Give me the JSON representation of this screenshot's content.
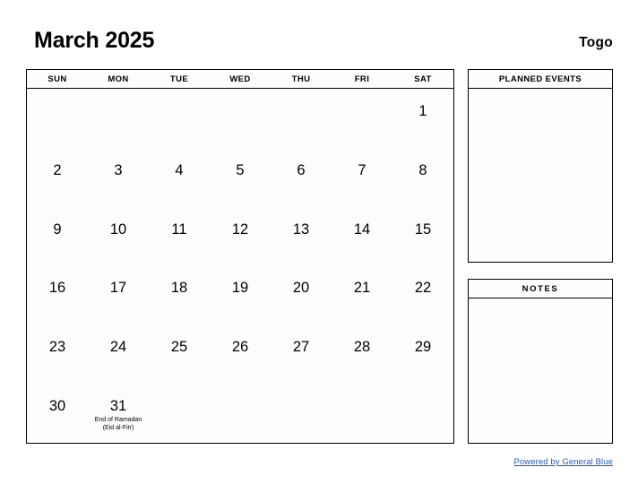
{
  "header": {
    "title": "March 2025",
    "region": "Togo"
  },
  "calendar": {
    "weekdays": [
      "SUN",
      "MON",
      "TUE",
      "WED",
      "THU",
      "FRI",
      "SAT"
    ],
    "weeks": [
      [
        {
          "day": "",
          "event": ""
        },
        {
          "day": "",
          "event": ""
        },
        {
          "day": "",
          "event": ""
        },
        {
          "day": "",
          "event": ""
        },
        {
          "day": "",
          "event": ""
        },
        {
          "day": "",
          "event": ""
        },
        {
          "day": "1",
          "event": ""
        }
      ],
      [
        {
          "day": "2",
          "event": ""
        },
        {
          "day": "3",
          "event": ""
        },
        {
          "day": "4",
          "event": ""
        },
        {
          "day": "5",
          "event": ""
        },
        {
          "day": "6",
          "event": ""
        },
        {
          "day": "7",
          "event": ""
        },
        {
          "day": "8",
          "event": ""
        }
      ],
      [
        {
          "day": "9",
          "event": ""
        },
        {
          "day": "10",
          "event": ""
        },
        {
          "day": "11",
          "event": ""
        },
        {
          "day": "12",
          "event": ""
        },
        {
          "day": "13",
          "event": ""
        },
        {
          "day": "14",
          "event": ""
        },
        {
          "day": "15",
          "event": ""
        }
      ],
      [
        {
          "day": "16",
          "event": ""
        },
        {
          "day": "17",
          "event": ""
        },
        {
          "day": "18",
          "event": ""
        },
        {
          "day": "19",
          "event": ""
        },
        {
          "day": "20",
          "event": ""
        },
        {
          "day": "21",
          "event": ""
        },
        {
          "day": "22",
          "event": ""
        }
      ],
      [
        {
          "day": "23",
          "event": ""
        },
        {
          "day": "24",
          "event": ""
        },
        {
          "day": "25",
          "event": ""
        },
        {
          "day": "26",
          "event": ""
        },
        {
          "day": "27",
          "event": ""
        },
        {
          "day": "28",
          "event": ""
        },
        {
          "day": "29",
          "event": ""
        }
      ],
      [
        {
          "day": "30",
          "event": ""
        },
        {
          "day": "31",
          "event": "End of Ramadan (Eid al-Fitr)"
        },
        {
          "day": "",
          "event": ""
        },
        {
          "day": "",
          "event": ""
        },
        {
          "day": "",
          "event": ""
        },
        {
          "day": "",
          "event": ""
        },
        {
          "day": "",
          "event": ""
        }
      ]
    ]
  },
  "panels": {
    "planned_events_title": "PLANNED EVENTS",
    "planned_events_body": "",
    "notes_title": "NOTES",
    "notes_body": ""
  },
  "footer": {
    "link_text": "Powered by General Blue",
    "link_color": "#2159c4"
  }
}
